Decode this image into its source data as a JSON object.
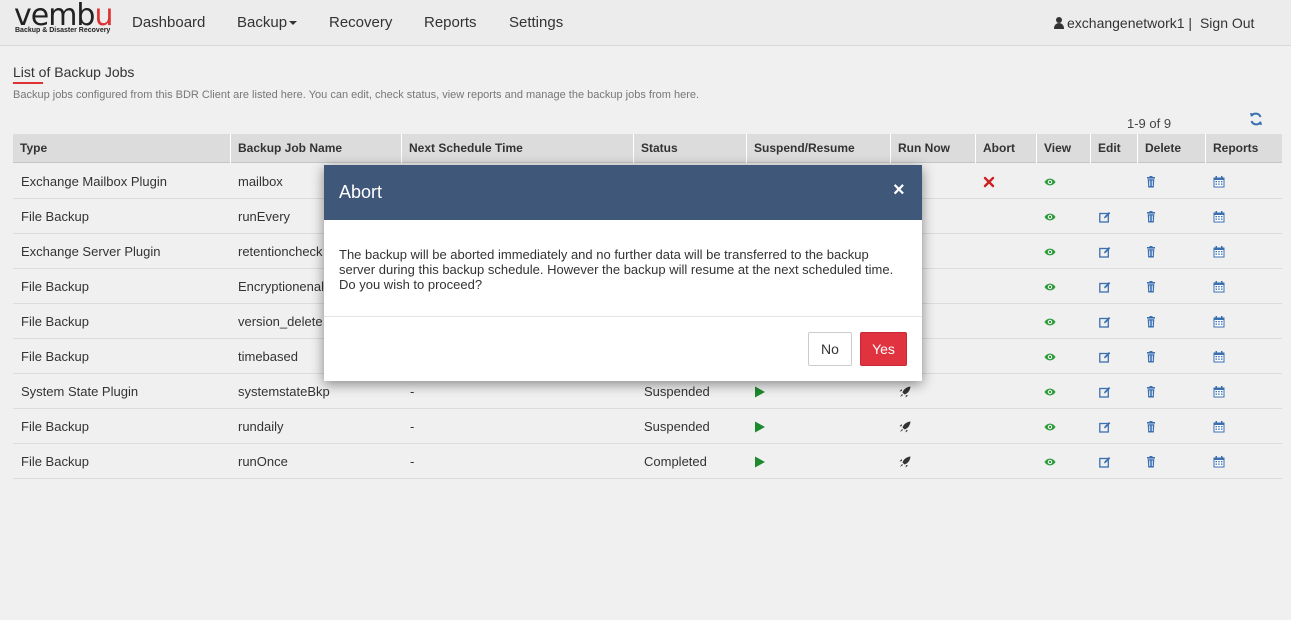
{
  "brand": {
    "logo_text_a": "vemb",
    "logo_text_b": "u",
    "logo_sub": "Backup & Disaster Recovery"
  },
  "nav": {
    "dashboard": "Dashboard",
    "backup": "Backup",
    "recovery": "Recovery",
    "reports": "Reports",
    "settings": "Settings"
  },
  "user": {
    "name": "exchangenetwork1",
    "separator": "|",
    "signout": "Sign Out"
  },
  "page": {
    "title": "List of Backup Jobs",
    "description": "Backup jobs configured from this BDR Client are listed here. You can edit, check status, view reports and manage the backup jobs from here.",
    "pager": "1-9 of 9"
  },
  "table": {
    "headers": {
      "type": "Type",
      "name": "Backup Job Name",
      "next": "Next Schedule Time",
      "status": "Status",
      "suspend": "Suspend/Resume",
      "run": "Run Now",
      "abort": "Abort",
      "view": "View",
      "edit": "Edit",
      "delete": "Delete",
      "reports": "Reports"
    },
    "rows": [
      {
        "type": "Exchange Mailbox Plugin",
        "name": "mailbox",
        "next": "",
        "status": ""
      },
      {
        "type": "File Backup",
        "name": "runEvery",
        "next": "",
        "status": ""
      },
      {
        "type": "Exchange Server Plugin",
        "name": "retentioncheck",
        "next": "",
        "status": ""
      },
      {
        "type": "File Backup",
        "name": "Encryptionenal",
        "next": "",
        "status": ""
      },
      {
        "type": "File Backup",
        "name": "version_delete",
        "next": "",
        "status": ""
      },
      {
        "type": "File Backup",
        "name": "timebased",
        "next": "",
        "status": ""
      },
      {
        "type": "System State Plugin",
        "name": "systemstateBkp",
        "next": "-",
        "status": "Suspended"
      },
      {
        "type": "File Backup",
        "name": "rundaily",
        "next": "-",
        "status": "Suspended"
      },
      {
        "type": "File Backup",
        "name": "runOnce",
        "next": "-",
        "status": "Completed"
      }
    ]
  },
  "modal": {
    "title": "Abort",
    "close": "×",
    "body": "The backup will be aborted immediately and no further data will be transferred to the backup server during this backup schedule. However the backup will resume at the next scheduled time. Do you wish to proceed?",
    "no": "No",
    "yes": "Yes"
  },
  "colors": {
    "header": "#3f5779",
    "yes": "#e0323f",
    "view": "#2e9c3a",
    "edit": "#3a6fb0",
    "abort": "#cc2222"
  }
}
